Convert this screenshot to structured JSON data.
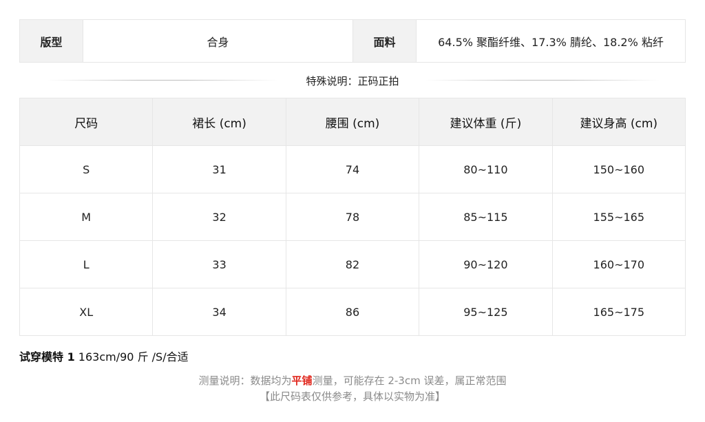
{
  "info": {
    "fit_label": "版型",
    "fit_value": "合身",
    "fabric_label": "面料",
    "fabric_value": "64.5% 聚酯纤维、17.3% 腈纶、18.2% 粘纤"
  },
  "special_note": "特殊说明：正码正拍",
  "size_table": {
    "headers": [
      "尺码",
      "裙长 (cm)",
      "腰围 (cm)",
      "建议体重 (斤)",
      "建议身高 (cm)"
    ],
    "rows": [
      [
        "S",
        "31",
        "74",
        "80~110",
        "150~160"
      ],
      [
        "M",
        "32",
        "78",
        "85~115",
        "155~165"
      ],
      [
        "L",
        "33",
        "82",
        "90~120",
        "160~170"
      ],
      [
        "XL",
        "34",
        "86",
        "95~125",
        "165~175"
      ]
    ]
  },
  "model": {
    "label": "试穿模特 1",
    "value": " 163cm/90 斤 /S/合适"
  },
  "measure_note": {
    "prefix": "测量说明：数据均为",
    "highlight": "平铺",
    "suffix": "测量，可能存在 2-3cm 误差，属正常范围",
    "line2": "【此尺码表仅供参考，具体以实物为准】"
  },
  "colors": {
    "header_bg": "#f2f2f2",
    "border": "#e6e6e6",
    "highlight": "#e0251b",
    "note_text": "#8a8a8a"
  }
}
